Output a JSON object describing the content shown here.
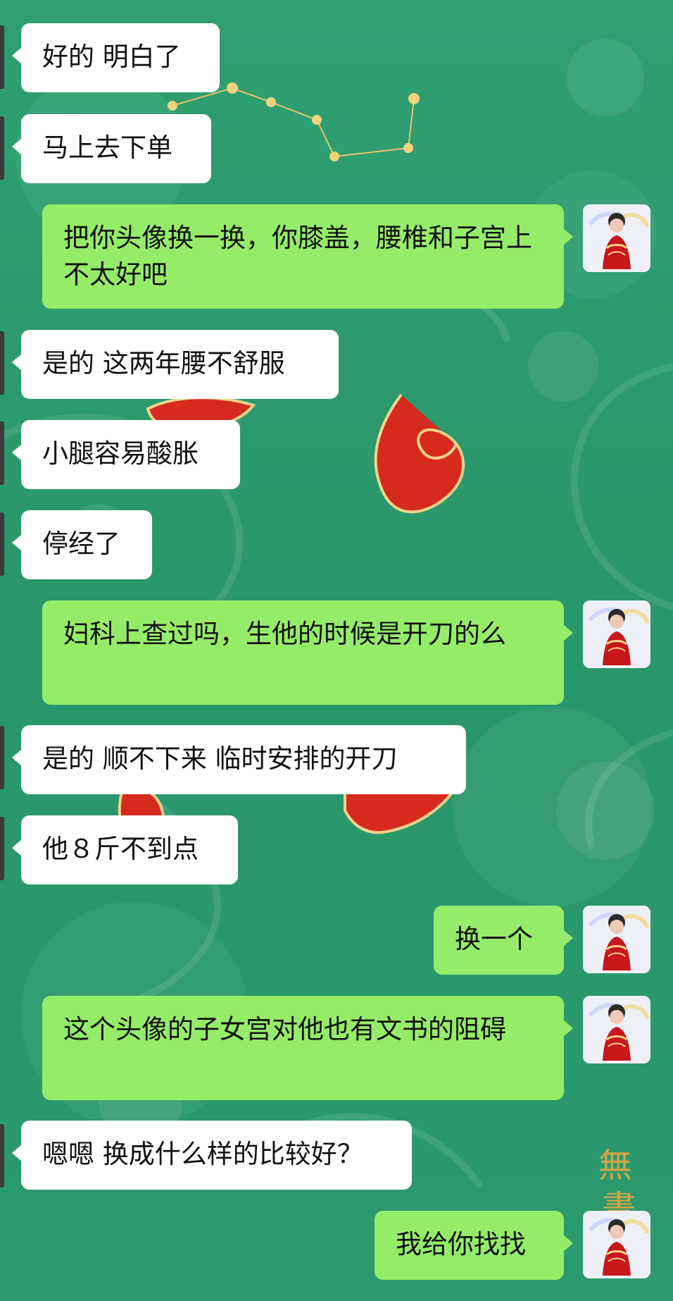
{
  "chat": {
    "messages": [
      {
        "side": "left",
        "text": "好的 明白了"
      },
      {
        "side": "left",
        "text": "马上去下单"
      },
      {
        "side": "right",
        "text": "把你头像换一换，你膝盖，腰椎和子宫上不太好吧"
      },
      {
        "side": "left",
        "text": "是的 这两年腰不舒服"
      },
      {
        "side": "left",
        "text": "小腿容易酸胀"
      },
      {
        "side": "left",
        "text": "停经了"
      },
      {
        "side": "right",
        "text": "妇科上查过吗，生他的时候是开刀的么"
      },
      {
        "side": "left",
        "text": "是的 顺不下来 临时安排的开刀"
      },
      {
        "side": "left",
        "text": "他８斤不到点"
      },
      {
        "side": "right",
        "text": "换一个"
      },
      {
        "side": "right",
        "text": "这个头像的子女宫对他也有文书的阻碍"
      },
      {
        "side": "left",
        "text": "嗯嗯 换成什么样的比较好？"
      },
      {
        "side": "right",
        "text": "我给你找找"
      }
    ]
  },
  "colors": {
    "background": "#2b9a6e",
    "incoming_bubble": "#ffffff",
    "outgoing_bubble": "#95ec69",
    "text": "#111111"
  },
  "icons": {
    "self_avatar": "woman-in-red-robe-avatar-icon",
    "contact_avatar_edge": "contact-avatar-icon"
  }
}
